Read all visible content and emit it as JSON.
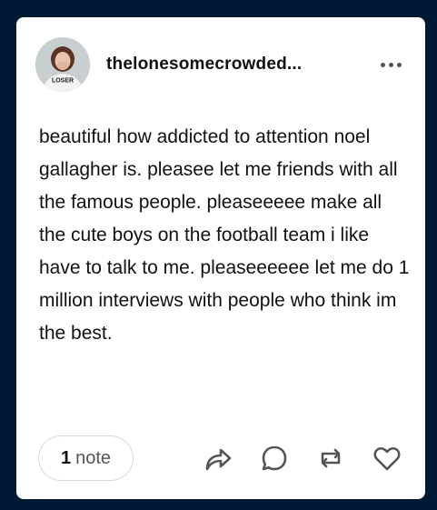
{
  "post": {
    "username": "thelonesomecrowded...",
    "avatar_text": "LOSER",
    "body_text": "beautiful how addicted to attention noel gallagher is. pleasee let me friends with all the famous people. pleaseeeee make all the cute boys on the football team i like have to talk to me. pleaseeeeee let me do 1 million interviews with people who think im the best.",
    "notes_count": "1",
    "notes_label": "note"
  },
  "icons": {
    "more": "more-options-icon",
    "share": "share-icon",
    "reply": "reply-icon",
    "reblog": "reblog-icon",
    "like": "heart-icon"
  },
  "colors": {
    "background": "#001935",
    "card": "#ffffff",
    "icon": "#555555"
  }
}
